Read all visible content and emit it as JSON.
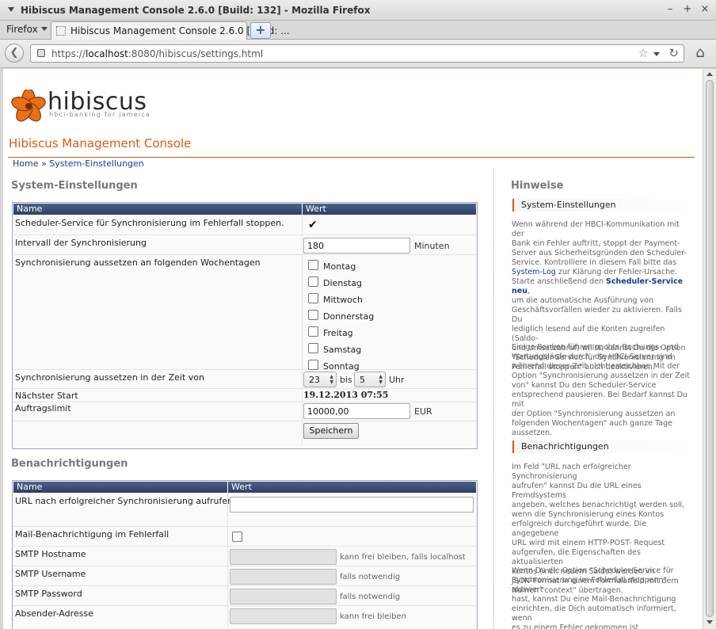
{
  "window": {
    "title": "Hibiscus Management Console 2.6.0 [Build: 132] - Mozilla Firefox",
    "controls": [
      "–",
      "+",
      "×"
    ]
  },
  "tabbar": {
    "app_menu": "Firefox",
    "active_tab": "Hibiscus Management Console 2.6.0 [Build: ...",
    "new_tab_label": "+"
  },
  "navbar": {
    "url_prefix": "https://",
    "url_host": "localhost",
    "url_rest": ":8080/hibiscus/settings.html"
  },
  "header": {
    "logo_word": "hibiscus",
    "logo_tagline": "hbci-banking for jameica",
    "console_title": "Hibiscus Management Console",
    "breadcrumb": "Home » System-Einstellungen"
  },
  "system": {
    "title": "System-Einstellungen",
    "col_name": "Name",
    "col_value": "Wert",
    "scheduler_stop_label": "Scheduler-Service für Synchronisierung im Fehlerfall stoppen.",
    "scheduler_stop_checked": true,
    "interval_label": "Intervall der Synchronisierung",
    "interval_value": "180",
    "interval_unit": "Minuten",
    "weekdays_label": "Synchronisierung aussetzen an folgenden Wochentagen",
    "weekdays": [
      {
        "label": "Montag",
        "checked": false
      },
      {
        "label": "Dienstag",
        "checked": false
      },
      {
        "label": "Mittwoch",
        "checked": false
      },
      {
        "label": "Donnerstag",
        "checked": false
      },
      {
        "label": "Freitag",
        "checked": false
      },
      {
        "label": "Samstag",
        "checked": false
      },
      {
        "label": "Sonntag",
        "checked": false
      }
    ],
    "time_label": "Synchronisierung aussetzen in der Zeit von",
    "time_from": "23",
    "time_to_label": "bis",
    "time_to": "5",
    "time_unit": "Uhr",
    "next_start_label": "Nächster Start",
    "next_start_value": "19.12.2013 07:55",
    "limit_label": "Auftragslimit",
    "limit_value": "10000,00",
    "limit_unit": "EUR",
    "save_label": "Speichern"
  },
  "notifications": {
    "title": "Benachrichtigungen",
    "col_name": "Name",
    "col_value": "Wert",
    "url_label": "URL nach erfolgreicher Synchronisierung aufrufen",
    "url_value": "",
    "mail_label": "Mail-Benachrichtigung im Fehlerfall",
    "mail_checked": false,
    "smtp_host_label": "SMTP Hostname",
    "smtp_host_hint": "kann frei bleiben, falls localhost",
    "smtp_user_label": "SMTP Username",
    "smtp_user_hint": "falls notwendig",
    "smtp_pass_label": "SMTP Password",
    "smtp_pass_hint": "falls notwendig",
    "sender_label": "Absender-Adresse",
    "sender_hint": "kann frei bleiben"
  },
  "hints": {
    "title": "Hinweise",
    "system_head": "System-Einstellungen",
    "system_p1_a": "Wenn während der HBCI-Kommunikation mit der\nBank ein Fehler auftritt, stoppt der Payment-\nServer aus Sicherheitsgründen den Scheduler-\nService. Kontrolliere in diesem Fall bitte das\n",
    "system_p1_link1": "System-Log",
    "system_p1_b": " zur Klärung der Fehler-Ursache.\nStarte anschließend den ",
    "system_p1_link2": "Scheduler-Service neu",
    "system_p1_c": ",\num die automatische Ausführung von\nGeschäftsvorfällen wieder zu aktivieren. Falls Du\nlediglich lesend auf die Konten zugreifen (Saldo-\nund Umsatzabruf) willst, kannst Du die Option\n\"Scheduler-Service für Synchronisierung im\nFehlerfall stoppen\" auch deaktivieren.",
    "system_p2": "Einige Banken führen nachts Buchungs- und\nWartungsläufe durch, die HBCI-Server sind\nwährend dieser Zeit nicht erreichbar. Mit der\nOption \"Synchronisierung aussetzen in der Zeit\nvon\" kannst Du den Scheduler-Service\nentsprechend pausieren. Bei Bedarf kannst Du mit\nder Option \"Synchronisierung aussetzen an\nfolgenden Wochentagen\" auch ganze Tage\naussetzen.",
    "notif_head": "Benachrichtigungen",
    "notif_p1": "Im Feld \"URL nach erfolgreicher Synchronisierung\naufrufen\" kannst Du die URL eines Fremdsystems\nangeben, welches benachrichtigt werden soll,\nwenn die Synchronisierung eines Kontos\nerfolgreich durchgeführt wurde. Die angegebene\nURL wird mit einem HTTP-POST- Request\naufgerufen, die Eigenschaften des aktualisierten\nKontos (incl. neuem Saldo) werden im\nJSON-Format in einem Formularfeld mit dem\nNamen \"context\" übertragen.",
    "notif_p2": "Wenn Du die Option \"Scheduler-Service für\nSynchronisierung im Fehlerfall stoppenn\" aktiviert\nhast, kannst Du eine Mail-Benachrichtigung\neinrichten, die Dich automatisch informiert, wenn\nes zu einem Fehler gekommen ist."
  },
  "colors": {
    "accent": "#d95a12",
    "link": "#1c3a8c",
    "table_header": "#2e3e63"
  }
}
